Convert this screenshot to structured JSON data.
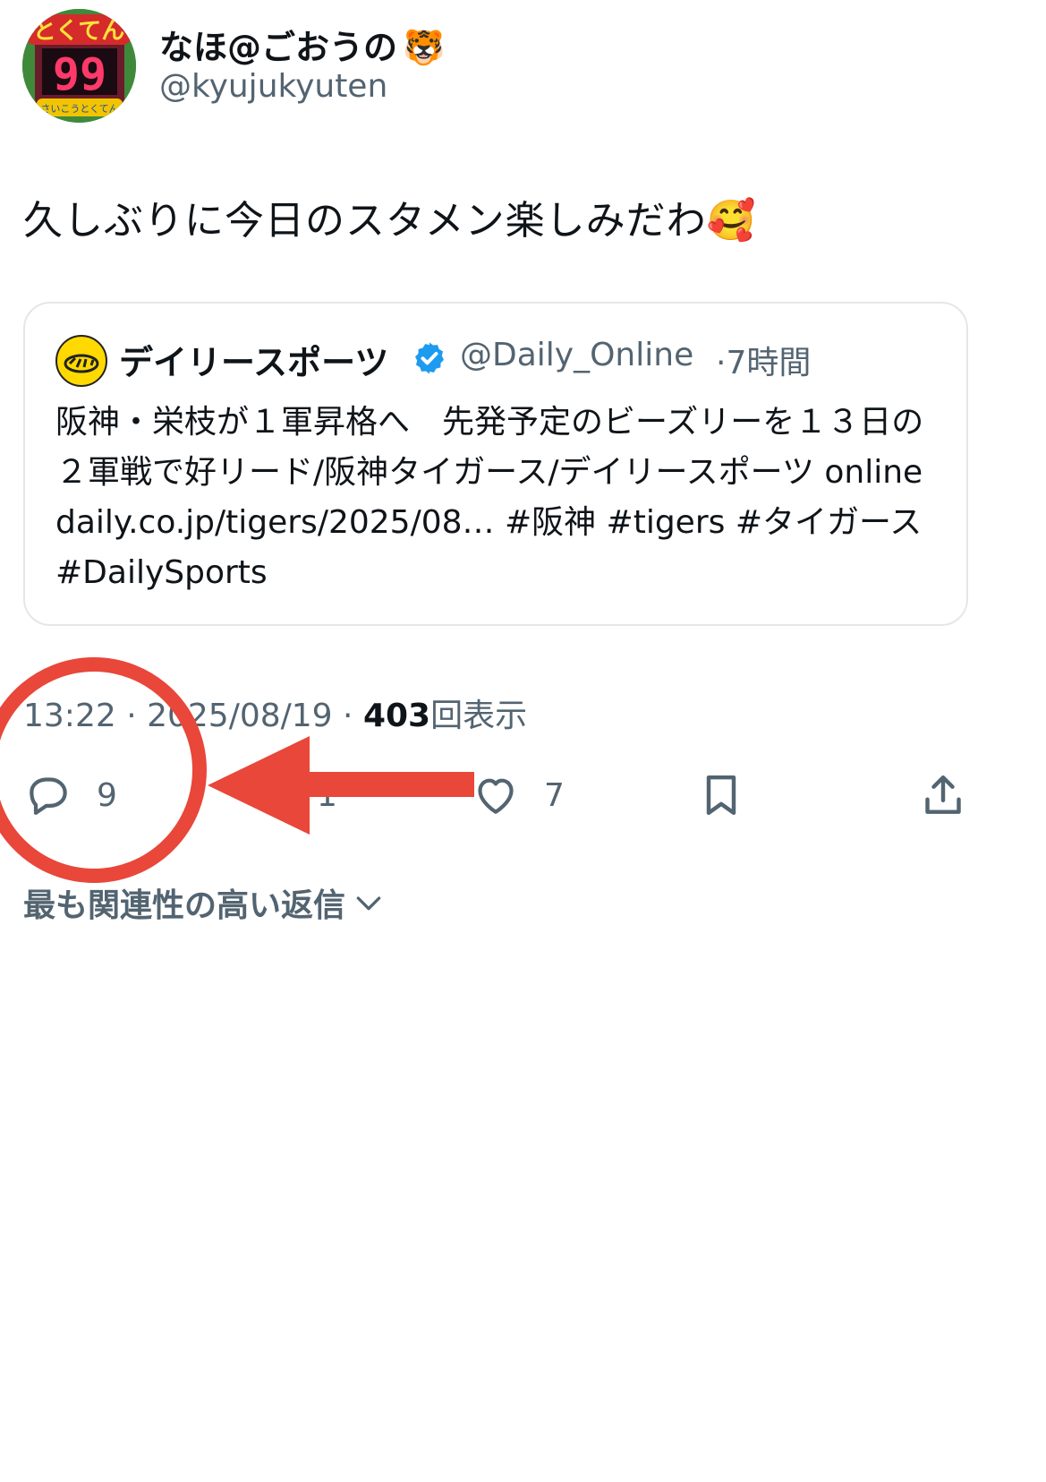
{
  "author": {
    "display_name": "なほ@ごおうの",
    "name_emoji": "🐯",
    "handle": "@kyujukyuten",
    "avatar_text_top": "とくてん",
    "avatar_number": "99",
    "avatar_text_bottom": "さいこうとくてん"
  },
  "tweet": {
    "text": "久しぶりに今日のスタメン楽しみだわ🥰"
  },
  "quote": {
    "name": "デイリースポーツ",
    "handle": "@Daily_Online",
    "separator": "·",
    "time": "7時間",
    "body": "阪神・栄枝が１軍昇格へ　先発予定のビーズリーを１３日の２軍戦で好リード/阪神タイガース/デイリースポーツ online daily.co.jp/tigers/2025/08… #阪神 #tigers #タイガース #DailySports"
  },
  "meta": {
    "time": "13:22",
    "sep1": " · ",
    "date": "2025/08/19",
    "sep2": " · ",
    "views": "403",
    "views_label": "回表示"
  },
  "actions": {
    "reply_count": "9",
    "repost_count": "1",
    "like_count": "7",
    "icons": [
      "reply-icon",
      "repost-icon",
      "like-icon",
      "bookmark-icon",
      "share-icon"
    ]
  },
  "replies_sort": {
    "label": "最も関連性の高い返信"
  },
  "colors": {
    "text_primary": "#0f1419",
    "text_secondary": "#536471",
    "verified_blue": "#1d9bf0",
    "annotation_red": "#e8473a",
    "card_border": "#e3e7ea"
  }
}
